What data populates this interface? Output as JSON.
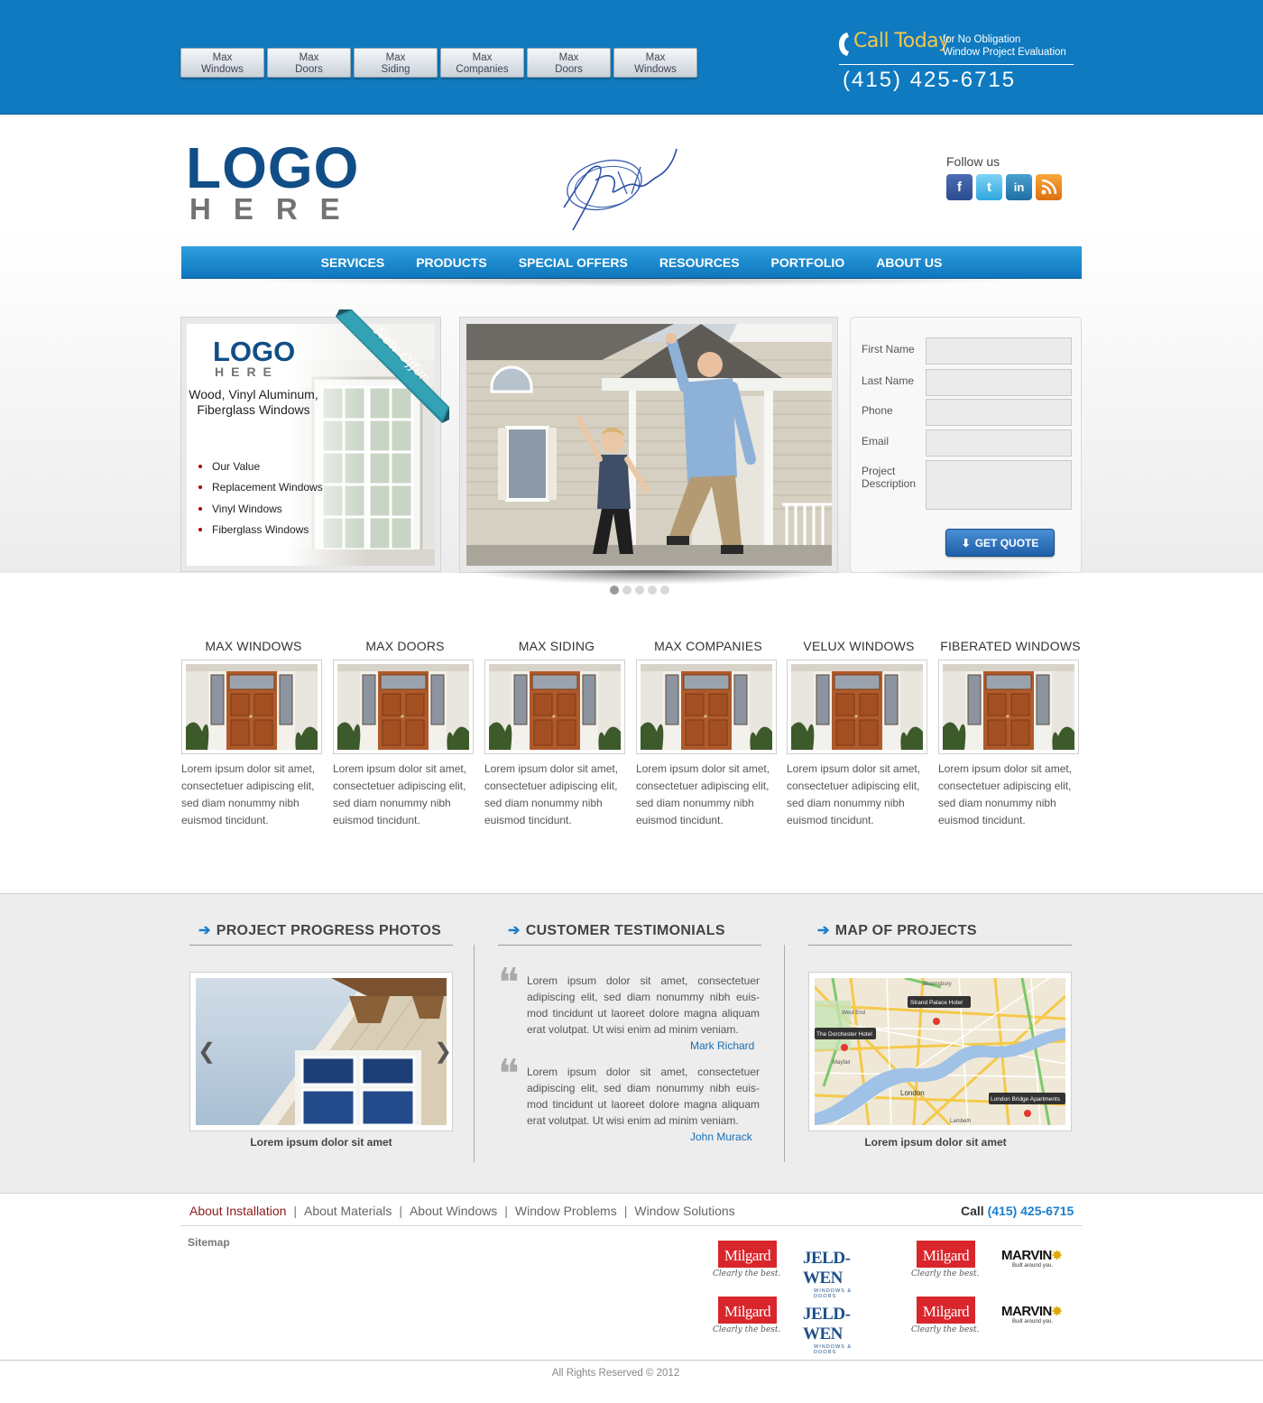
{
  "top_tabs": [
    {
      "line1": "Max",
      "line2": "Windows"
    },
    {
      "line1": "Max",
      "line2": "Doors"
    },
    {
      "line1": "Max",
      "line2": "Siding"
    },
    {
      "line1": "Max",
      "line2": "Companies"
    },
    {
      "line1": "Max",
      "line2": "Doors"
    },
    {
      "line1": "Max",
      "line2": "Windows"
    }
  ],
  "call": {
    "headline": "Call Today",
    "sub1": "for No Obligation",
    "sub2": "Window Project Evaluation",
    "number": "(415) 425-6715"
  },
  "logo": {
    "line1": "LOGO",
    "line2": "HERE"
  },
  "follow": {
    "label": "Follow us",
    "icons": [
      "facebook-icon",
      "twitter-icon",
      "linkedin-icon",
      "rss-icon"
    ]
  },
  "nav": [
    "SERVICES",
    "PRODUCTS",
    "SPECIAL OFFERS",
    "RESOURCES",
    "PORTFOLIO",
    "ABOUT US"
  ],
  "offer": {
    "logo1": "LOGO",
    "logo2": "HERE",
    "ribbon": "New Offer",
    "text": "Wood, Vinyl Aluminum, Fiberglass Windows",
    "list": [
      "Our Value",
      "Replacement Windows",
      "Vinyl Windows",
      "Fiberglass Windows"
    ]
  },
  "slider": {
    "slides": 5,
    "active": 1
  },
  "form": {
    "fields": [
      "First Name",
      "Last Name",
      "Phone",
      "Email"
    ],
    "project_label1": "Project",
    "project_label2": "Description",
    "button": "GET QUOTE"
  },
  "products": [
    {
      "title": "MAX WINDOWS",
      "desc": "Lorem ipsum dolor sit amet, consectetuer adipiscing elit, sed diam nonummy nibh euismod tincidunt."
    },
    {
      "title": "MAX DOORS",
      "desc": "Lorem ipsum dolor sit amet, consectetuer adipiscing elit, sed diam nonummy nibh euismod tincidunt."
    },
    {
      "title": "MAX SIDING",
      "desc": "Lorem ipsum dolor sit amet, consectetuer adipiscing elit, sed diam nonummy nibh euismod tincidunt."
    },
    {
      "title": "MAX COMPANIES",
      "desc": "Lorem ipsum dolor sit amet, consectetuer adipiscing elit, sed diam nonummy nibh euismod tincidunt."
    },
    {
      "title": "VELUX WINDOWS",
      "desc": "Lorem ipsum dolor sit amet, consectetuer adipiscing elit, sed diam nonummy nibh euismod tincidunt."
    },
    {
      "title": "FIBERATED WINDOWS",
      "desc": "Lorem ipsum dolor sit amet, consectetuer adipiscing elit, sed diam nonummy nibh euismod tincidunt."
    }
  ],
  "sections": {
    "photos": {
      "title": "PROJECT PROGRESS PHOTOS",
      "caption": "Lorem ipsum dolor sit amet",
      "prev": "❮",
      "next": "❯"
    },
    "testimonials": {
      "title": "CUSTOMER TESTIMONIALS",
      "items": [
        {
          "text": "Lorem ipsum dolor sit amet, consectetuer adipiscing elit, sed diam nonummy nibh euis-mod tincidunt ut laoreet dolore magna aliquam erat volutpat. Ut wisi enim ad minim veniam.",
          "name": "Mark Richard"
        },
        {
          "text": "Lorem ipsum dolor sit amet, consectetuer adipiscing elit, sed diam nonummy nibh euis-mod tincidunt ut laoreet dolore magna aliquam erat volutpat. Ut wisi enim ad minim veniam.",
          "name": "John Murack"
        }
      ]
    },
    "map": {
      "title": "MAP OF PROJECTS",
      "caption": "Lorem ipsum dolor sit amet",
      "labels": [
        "Strand Palace Hotel",
        "The Dorchester Hotel",
        "London Bridge Apartments",
        "London",
        "Bloomsbury",
        "West End",
        "Mayfair",
        "Lambeth"
      ]
    }
  },
  "footer": {
    "links": [
      "About Installation",
      "About Materials",
      "About Windows",
      "Window Problems",
      "Window Solutions"
    ],
    "call_label": "Call",
    "call_number": "(415) 425-6715",
    "sitemap": "Sitemap",
    "brands": [
      "Milgard",
      "JELD-WEN",
      "Milgard",
      "MARVIN",
      "Milgard",
      "JELD-WEN",
      "Milgard",
      "MARVIN"
    ],
    "brand_tags": {
      "milgard": "Clearly the best.",
      "jeldwen": "WINDOWS & DOORS",
      "marvin": "Built around you."
    },
    "copyright": "All Rights Reserved © 2012"
  },
  "colors": {
    "brand_blue": "#0f7ac0",
    "nav_blue": "#1a86cf",
    "logo_blue": "#114e87",
    "call_yellow": "#f5c64a",
    "link_blue": "#1a6fb3",
    "accent_red": "#8b1a1a"
  }
}
